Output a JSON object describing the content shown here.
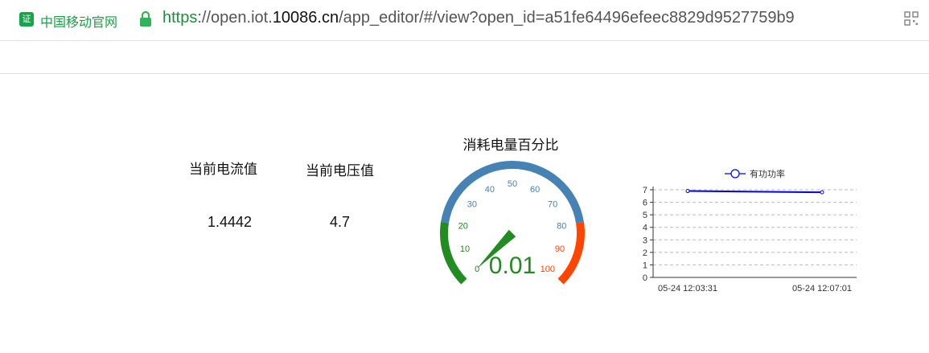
{
  "browser": {
    "site_name": "中国移动官网",
    "site_badge": "证",
    "url_protocol": "https",
    "url_prefix": "://open.iot.",
    "url_domain": "10086.cn",
    "url_path": "/app_editor/#/view?open_id=a51fe64496efeec8829d9527759b9"
  },
  "metrics": {
    "current_label": "当前电流值",
    "current_value": "1.4442",
    "voltage_label": "当前电压值",
    "voltage_value": "4.7"
  },
  "gauge": {
    "title": "消耗电量百分比",
    "value": 0.01,
    "value_text": "0.01",
    "min": 0,
    "max": 100,
    "tick_labels": [
      "0",
      "10",
      "20",
      "30",
      "40",
      "50",
      "60",
      "70",
      "80",
      "90",
      "100"
    ],
    "bands": [
      {
        "to": 20,
        "color": "#228b22"
      },
      {
        "to": 80,
        "color": "#4682b4"
      },
      {
        "to": 100,
        "color": "#ff4500"
      }
    ],
    "pointer_color": "#228b22"
  },
  "chart_data": {
    "type": "line",
    "legend": "有功功率",
    "legend_position": "top",
    "x": [
      "05-24 12:03:31",
      "05-24 12:07:01"
    ],
    "series": [
      {
        "name": "有功功率",
        "values": [
          6.9,
          6.8
        ],
        "color": "#0000ff"
      }
    ],
    "ylim": [
      0,
      7
    ],
    "yticks": [
      "0",
      "1",
      "2",
      "3",
      "4",
      "5",
      "6",
      "7"
    ],
    "grid": true
  }
}
